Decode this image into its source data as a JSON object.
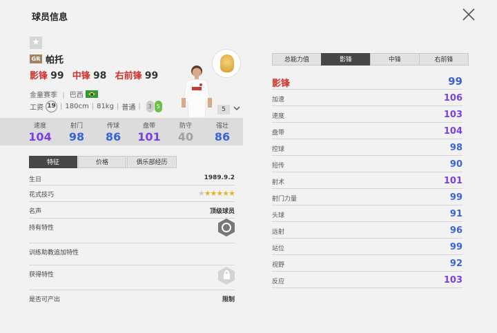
{
  "header": {
    "title": "球员信息"
  },
  "player": {
    "position_tag": "GR",
    "name": "帕托",
    "positions": [
      {
        "label": "影锋",
        "value": "99"
      },
      {
        "label": "中锋",
        "value": "98"
      },
      {
        "label": "右前锋",
        "value": "99"
      }
    ],
    "season": "金童赛季",
    "nationality": "巴西",
    "wage_label": "工资",
    "wage": "19",
    "height": "180cm",
    "weight": "81kg",
    "body_type": "普通",
    "weak_foot_left": "3",
    "weak_foot_right": "5",
    "level": "5"
  },
  "stats": [
    {
      "label": "速度",
      "value": "104",
      "color": "#7a3fe0"
    },
    {
      "label": "射门",
      "value": "98",
      "color": "#3a63d8"
    },
    {
      "label": "传球",
      "value": "86",
      "color": "#3a63d8"
    },
    {
      "label": "盘带",
      "value": "101",
      "color": "#7a3fe0"
    },
    {
      "label": "防守",
      "value": "40",
      "color": "#a0a0a0"
    },
    {
      "label": "强壮",
      "value": "86",
      "color": "#3a63d8"
    }
  ],
  "left_tabs": [
    "特征",
    "价格",
    "俱乐部经历"
  ],
  "details": {
    "birthday": {
      "label": "生日",
      "value": "1989.9.2"
    },
    "skill_moves": {
      "label": "花式技巧",
      "stars": 5,
      "max": 5
    },
    "reputation": {
      "label": "名声",
      "value": "顶级球员"
    },
    "owned_traits": {
      "label": "持有特性"
    },
    "coach_traits": {
      "label": "训练助教追加特性"
    },
    "acquired_traits": {
      "label": "获得特性"
    },
    "producible": {
      "label": "是否可产出",
      "value": "限制"
    }
  },
  "right_tabs": [
    "总能力值",
    "影锋",
    "中锋",
    "右前锋"
  ],
  "attributes": [
    {
      "label": "影锋",
      "value": "99",
      "color": "#3a63d8"
    },
    {
      "label": "加速",
      "value": "106",
      "color": "#7a3fe0"
    },
    {
      "label": "速度",
      "value": "103",
      "color": "#7a3fe0"
    },
    {
      "label": "盘带",
      "value": "104",
      "color": "#7a3fe0"
    },
    {
      "label": "控球",
      "value": "98",
      "color": "#3a63d8"
    },
    {
      "label": "短传",
      "value": "90",
      "color": "#3a63d8"
    },
    {
      "label": "射术",
      "value": "101",
      "color": "#7a3fe0"
    },
    {
      "label": "射门力量",
      "value": "99",
      "color": "#3a63d8"
    },
    {
      "label": "头球",
      "value": "91",
      "color": "#3a63d8"
    },
    {
      "label": "远射",
      "value": "96",
      "color": "#3a63d8"
    },
    {
      "label": "站位",
      "value": "99",
      "color": "#3a63d8"
    },
    {
      "label": "视野",
      "value": "92",
      "color": "#3a63d8"
    },
    {
      "label": "反应",
      "value": "103",
      "color": "#7a3fe0"
    }
  ]
}
